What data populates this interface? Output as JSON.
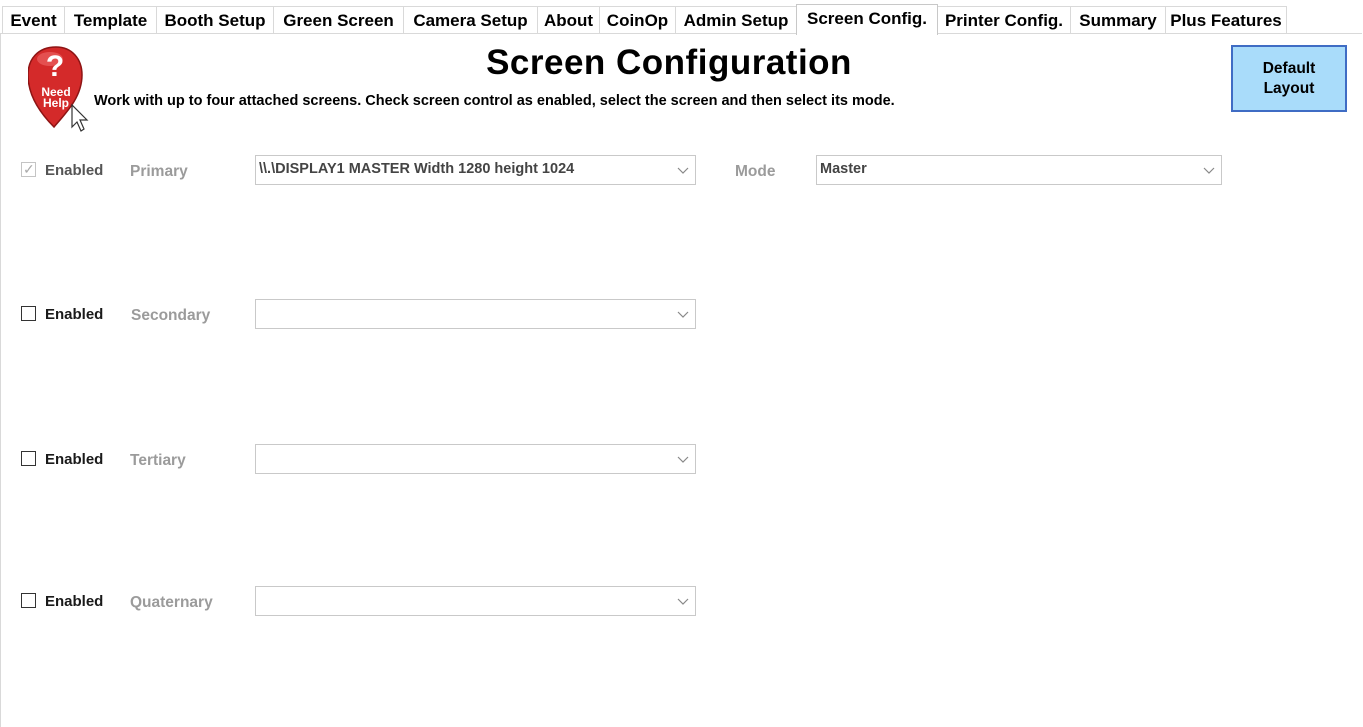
{
  "tabs": [
    {
      "label": "Event"
    },
    {
      "label": "Template"
    },
    {
      "label": "Booth Setup"
    },
    {
      "label": "Green Screen"
    },
    {
      "label": "Camera Setup"
    },
    {
      "label": "About"
    },
    {
      "label": "CoinOp"
    },
    {
      "label": "Admin Setup"
    },
    {
      "label": "Screen Config.",
      "active": true
    },
    {
      "label": "Printer Config."
    },
    {
      "label": "Summary"
    },
    {
      "label": "Plus Features"
    }
  ],
  "page": {
    "title": "Screen Configuration",
    "subtitle": "Work with up to four attached screens. Check screen control as enabled, select the screen and  then select its mode.",
    "help_icon_text": [
      "Need",
      "Help"
    ],
    "default_layout_button": [
      "Default",
      "Layout"
    ]
  },
  "screens": [
    {
      "enabled_label": "Enabled",
      "checked": true,
      "disabled": true,
      "role": "Primary",
      "screen_value": "\\\\.\\DISPLAY1  MASTER  Width 1280 height 1024",
      "mode_label": "Mode",
      "mode_value": "Master"
    },
    {
      "enabled_label": "Enabled",
      "checked": false,
      "role": "Secondary",
      "screen_value": ""
    },
    {
      "enabled_label": "Enabled",
      "checked": false,
      "role": "Tertiary",
      "screen_value": ""
    },
    {
      "enabled_label": "Enabled",
      "checked": false,
      "role": "Quaternary",
      "screen_value": ""
    }
  ],
  "colors": {
    "button_bg": "#a9dcfa",
    "button_border": "#3f6cc4",
    "help_red": "#d42a2a"
  }
}
